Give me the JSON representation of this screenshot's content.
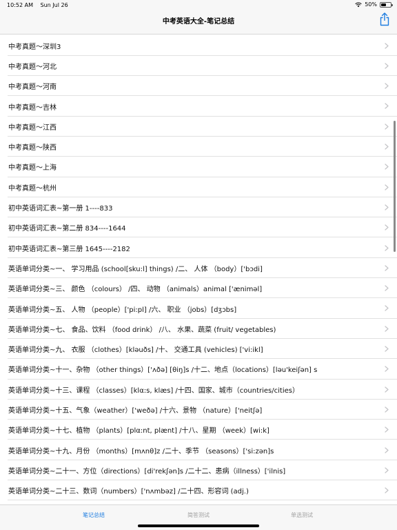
{
  "status_bar": {
    "time": "10:52 AM",
    "date": "Sun Jul 26",
    "battery": "50%",
    "battery_level": 0.5,
    "icons": [
      "wifi-icon",
      "battery-icon"
    ]
  },
  "nav": {
    "title": "中考英语大全-笔记总结",
    "action_icon": "share-icon"
  },
  "list": {
    "items": [
      {
        "label": "中考真题～深圳3"
      },
      {
        "label": "中考真题～河北"
      },
      {
        "label": "中考真题～河南"
      },
      {
        "label": "中考真题～吉林"
      },
      {
        "label": "中考真题～江西"
      },
      {
        "label": "中考真题～陕西"
      },
      {
        "label": "中考真题～上海"
      },
      {
        "label": "中考真题～杭州"
      },
      {
        "label": "初中英语词汇表~第一册 1----833"
      },
      {
        "label": "初中英语词汇表~第二册  834----1644"
      },
      {
        "label": "初中英语词汇表~第三册  1645----2182"
      },
      {
        "label": "英语单词分类~一、 学习用品 (school[sku:l] things) /二、 人体 （body）['bɔdi]"
      },
      {
        "label": "英语单词分类~三、 颜色 （colours） /四、 动物 （animals）animal ['æniməl]"
      },
      {
        "label": "英语单词分类~五、 人物 （people）['pi:pl] /六、 职业 （jobs）[dʒɔbs]"
      },
      {
        "label": "英语单词分类~七、 食品、饮料 （food drink） /八、 水果、蔬菜 (fruit/ vegetables)"
      },
      {
        "label": "英语单词分类~九、 衣服 （clothes）[kləuðs] /十、 交通工具 (vehicles) ['vi:ikl]"
      },
      {
        "label": "英语单词分类~十一、杂物 （other things）['ʌðə] [θiŋ]s /十二、地点（locations）[ləu'keiʃən] s"
      },
      {
        "label": "英语单词分类~十三、课程 （classes）[klα:s, klæs] /十四、国家、城市（countries/cities）"
      },
      {
        "label": "英语单词分类~十五、气象（weather）['weðə] /十六、景物 （nature）['neitʃə]"
      },
      {
        "label": "英语单词分类~十七、植物 （plants）[plα:nt, plænt] /十八、星期 （week）[wi:k]"
      },
      {
        "label": "英语单词分类~十九、月份 （months）[mʌnθ]z /二十、季节 （seasons）['si:zən]s"
      },
      {
        "label": "英语单词分类~二十一、方位（directions）[di'rekʃən]s /二十二、患病（illness）['ilnis]"
      },
      {
        "label": "英语单词分类~二十三、数词（numbers）['nʌmbəz] /二十四、形容词 (adj.)"
      }
    ]
  },
  "tabs": [
    {
      "label": "笔记总结",
      "active": true
    },
    {
      "label": "简答测试",
      "active": false
    },
    {
      "label": "单选测试",
      "active": false
    }
  ],
  "colors": {
    "accent": "#1f7de0",
    "bar_background": "#f7f7f7",
    "separator": "#e1e1e1",
    "chevron": "#c4c4c7",
    "tab_inactive": "#a0a0a0"
  }
}
